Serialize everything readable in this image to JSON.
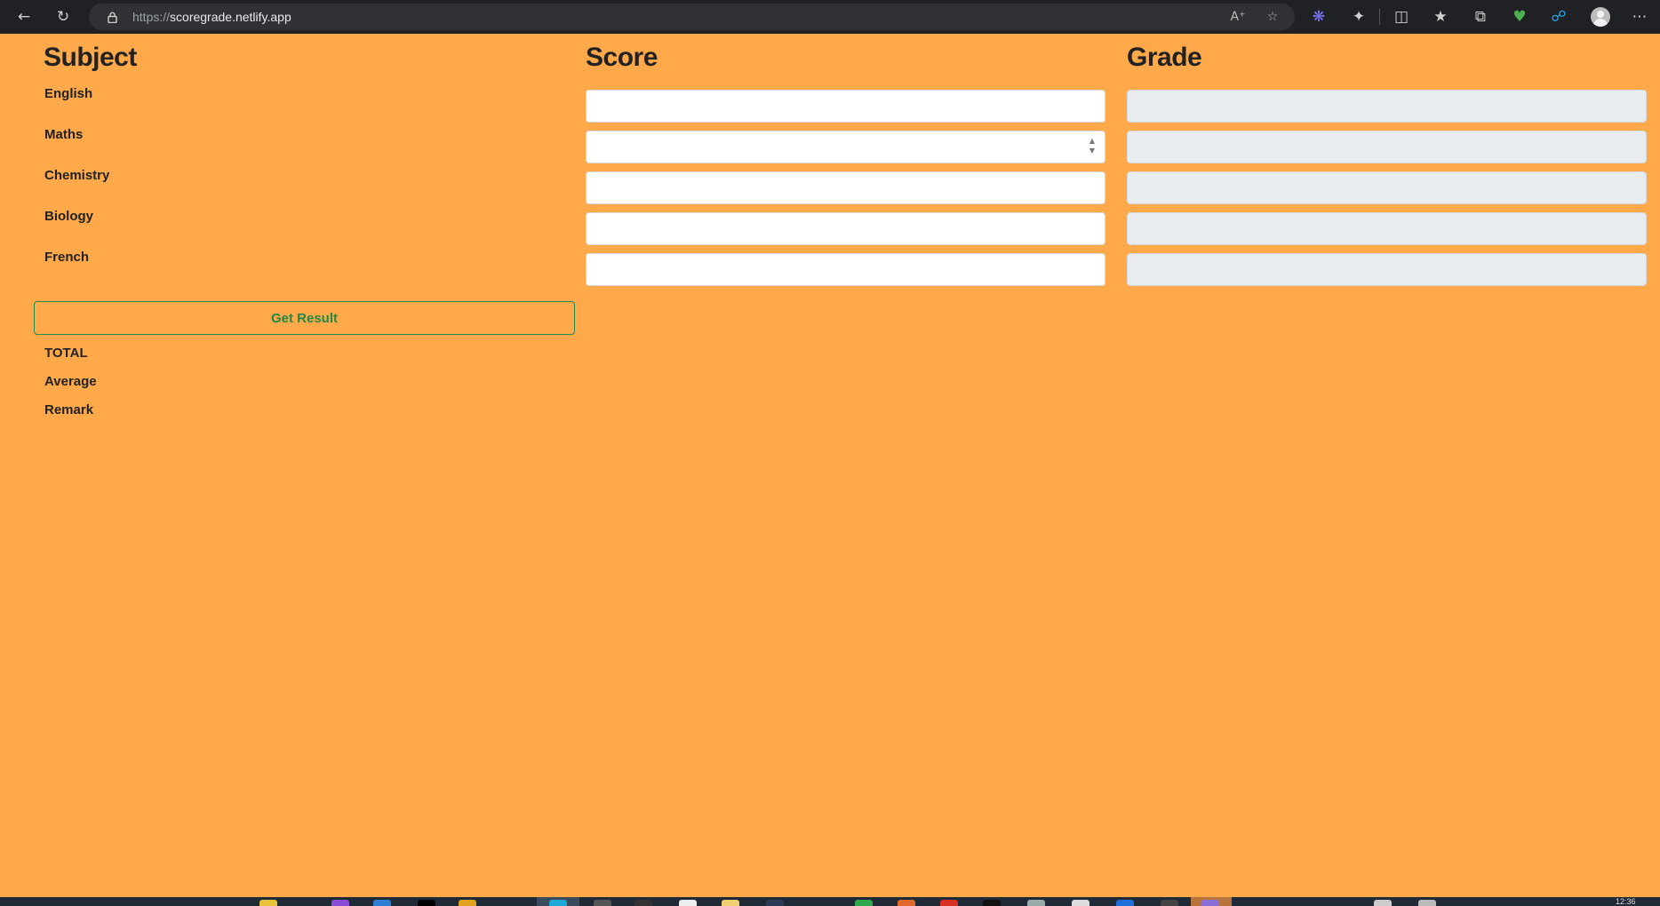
{
  "browser": {
    "url_protocol": "https://",
    "url_host": "scoregrade.netlify.app"
  },
  "headers": {
    "subject": "Subject",
    "score": "Score",
    "grade": "Grade"
  },
  "subjects": [
    "English",
    "Maths",
    "Chemistry",
    "Biology",
    "French"
  ],
  "scores": [
    "",
    "",
    "",
    "",
    ""
  ],
  "grades": [
    "",
    "",
    "",
    "",
    ""
  ],
  "get_result_label": "Get Result",
  "results": {
    "total_label": "TOTAL",
    "average_label": "Average",
    "remark_label": "Remark"
  },
  "taskbar": {
    "clock": "12:36"
  },
  "colors": {
    "page_background": "#ffa94a",
    "button_accent": "#1e8a48",
    "grade_field_background": "#e9ecef"
  }
}
